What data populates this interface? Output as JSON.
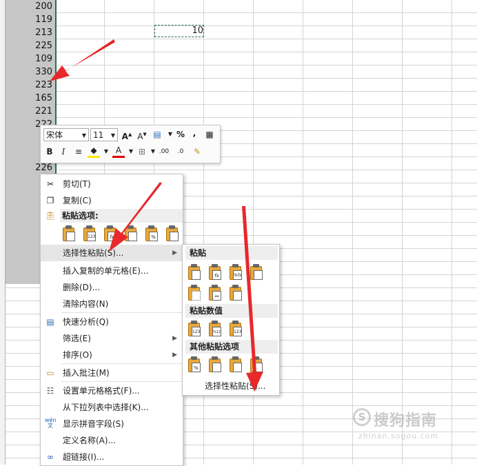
{
  "sheet": {
    "selected_column_values": [
      "200",
      "119",
      "213",
      "225",
      "109",
      "330",
      "223",
      "165",
      "221",
      "222",
      "",
      "",
      "",
      "226"
    ],
    "copied_cell_value": "10"
  },
  "mini_toolbar": {
    "font_name": "宋体",
    "font_size": "11",
    "percent_label": "%",
    "comma_label": ",",
    "bold_label": "B",
    "italic_label": "I",
    "font_color_label": "A",
    "increase_decimal_label": ".00",
    "decrease_decimal_label": ".0"
  },
  "context_menu": {
    "cut": "剪切(T)",
    "copy": "复制(C)",
    "paste_options": "粘贴选项:",
    "paste_special": "选择性粘贴(S)...",
    "insert_copied": "插入复制的单元格(E)...",
    "delete": "删除(D)...",
    "clear": "清除内容(N)",
    "quick_analysis": "快速分析(Q)",
    "filter": "筛选(E)",
    "sort": "排序(O)",
    "insert_comment": "插入批注(M)",
    "format_cells": "设置单元格格式(F)...",
    "pick_from_list": "从下拉列表中选择(K)...",
    "phonetic": "显示拼音字段(S)",
    "define_name": "定义名称(A)...",
    "hyperlink": "超链接(I)...",
    "paste_icon_labels": [
      "",
      "123",
      "fx",
      "",
      "%",
      ""
    ],
    "phonetic_icon": "wén 文"
  },
  "submenu": {
    "paste_header": "粘贴",
    "paste_values_header": "粘贴数值",
    "other_paste_header": "其他粘贴选项",
    "paste_special_footer": "选择性粘贴(S)...",
    "paste_row1": [
      "",
      "fx",
      "%fx",
      ""
    ],
    "paste_row2": [
      "",
      "↔",
      ""
    ],
    "values_row": [
      "123",
      "%123",
      "123"
    ],
    "other_row": [
      "%",
      "",
      "",
      ""
    ]
  },
  "watermark": {
    "text": "搜狗指南",
    "url": "zhinan.sogou.com"
  },
  "colors": {
    "selection_fill": "#c6c6c6",
    "excel_green": "#217346",
    "annotation_red": "#e8282b",
    "clipboard_orange": "#e9a93a"
  }
}
